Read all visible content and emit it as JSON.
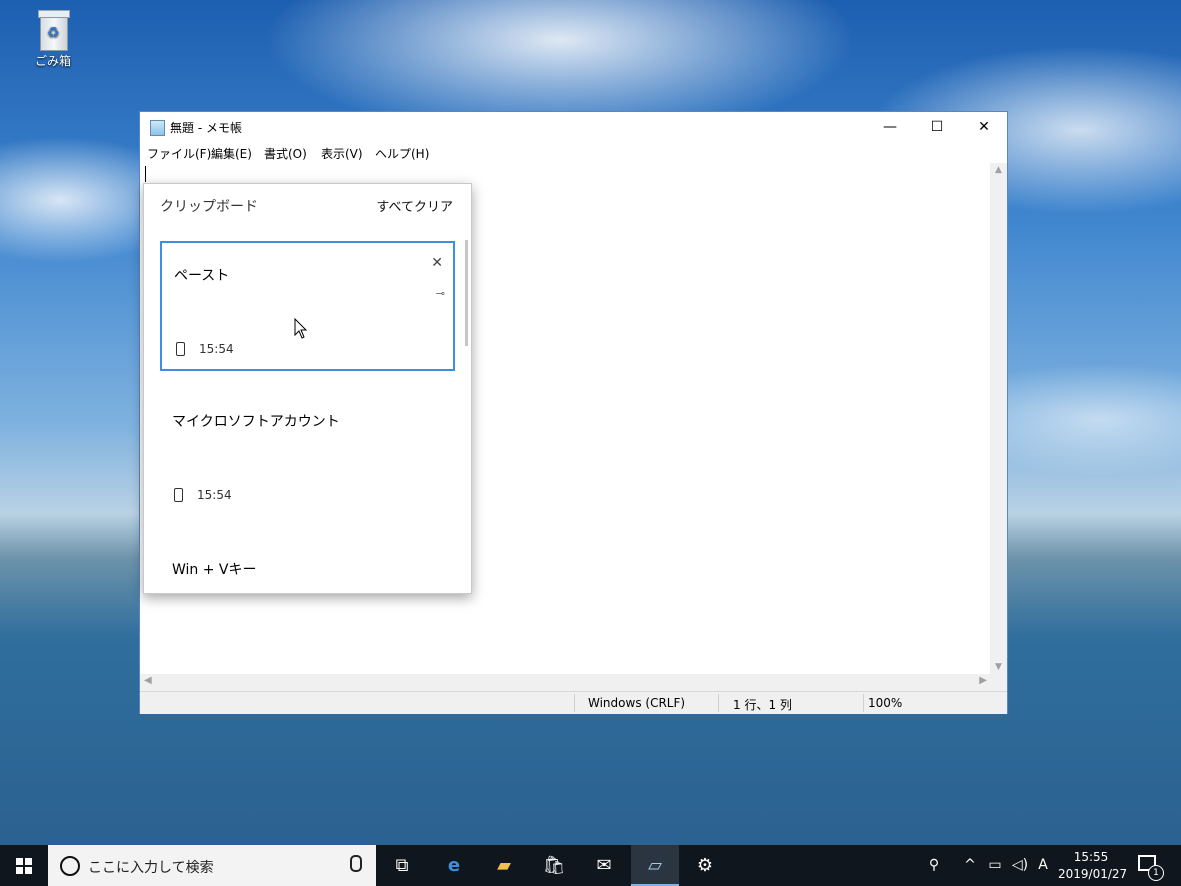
{
  "desktop": {
    "recycle_bin_label": "ごみ箱"
  },
  "window": {
    "title": "無題 - メモ帳",
    "controls": {
      "minimize": "—",
      "maximize": "☐",
      "close": "✕"
    },
    "menu": [
      "ファイル(F)",
      "編集(E)",
      "書式(O)",
      "表示(V)",
      "ヘルプ(H)"
    ]
  },
  "statusbar": {
    "line_ending": "Windows (CRLF)",
    "position": "1 行、1 列",
    "zoom": "100%"
  },
  "clipboard": {
    "title": "クリップボード",
    "clear_all": "すべてクリア",
    "items": [
      {
        "text": "ペースト",
        "time": "15:54",
        "selected": true
      },
      {
        "text": "マイクロソフトアカウント",
        "time": "15:54",
        "selected": false
      },
      {
        "text": "Win + Vキー",
        "time": "",
        "selected": false
      }
    ]
  },
  "taskbar": {
    "search_placeholder": "ここに入力して検索",
    "icons": [
      "windows-start-icon",
      "task-view-icon",
      "edge-icon",
      "file-explorer-icon",
      "store-icon",
      "mail-icon",
      "notepad-icon",
      "settings-icon"
    ],
    "tray": {
      "ime_mode": "A",
      "time": "15:55",
      "date": "2019/01/27",
      "notification_count": "1"
    }
  }
}
